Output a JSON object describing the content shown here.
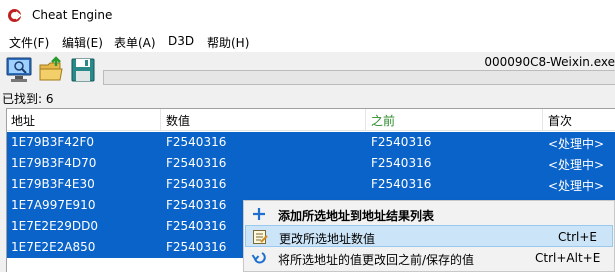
{
  "window": {
    "title": "Cheat Engine"
  },
  "menu": [
    "文件(F)",
    "编辑(E)",
    "表单(A)",
    "D3D",
    "帮助(H)"
  ],
  "process": "000090C8-Weixin.exe",
  "found_label": "已找到: 6",
  "columns": [
    "地址",
    "数值",
    "之前",
    "首次"
  ],
  "rows": [
    {
      "address": "1E79B3F42F0",
      "value": "F2540316",
      "previous": "F2540316",
      "first": "<处理中>"
    },
    {
      "address": "1E79B3F4D70",
      "value": "F2540316",
      "previous": "F2540316",
      "first": "<处理中>"
    },
    {
      "address": "1E79B3F4E30",
      "value": "F2540316",
      "previous": "F2540316",
      "first": "<处理中>"
    },
    {
      "address": "1E7A997E910",
      "value": "F2540316",
      "previous": "",
      "first": ""
    },
    {
      "address": "1E7E2E29DD0",
      "value": "F2540316",
      "previous": "",
      "first": ""
    },
    {
      "address": "1E7E2E2A850",
      "value": "F2540316",
      "previous": "",
      "first": ""
    }
  ],
  "context_menu": [
    {
      "label": "添加所选地址到地址结果列表",
      "shortcut": "",
      "icon": "plus-icon"
    },
    {
      "label": "更改所选地址数值",
      "shortcut": "Ctrl+E",
      "icon": "edit-icon"
    },
    {
      "label": "将所选地址的值更改回之前/保存的值",
      "shortcut": "Ctrl+Alt+E",
      "icon": "undo-icon"
    }
  ],
  "colors": {
    "selection": "#0a63c9",
    "previous_header": "#2a8a2a",
    "menu_highlight": "#cce4f7"
  }
}
